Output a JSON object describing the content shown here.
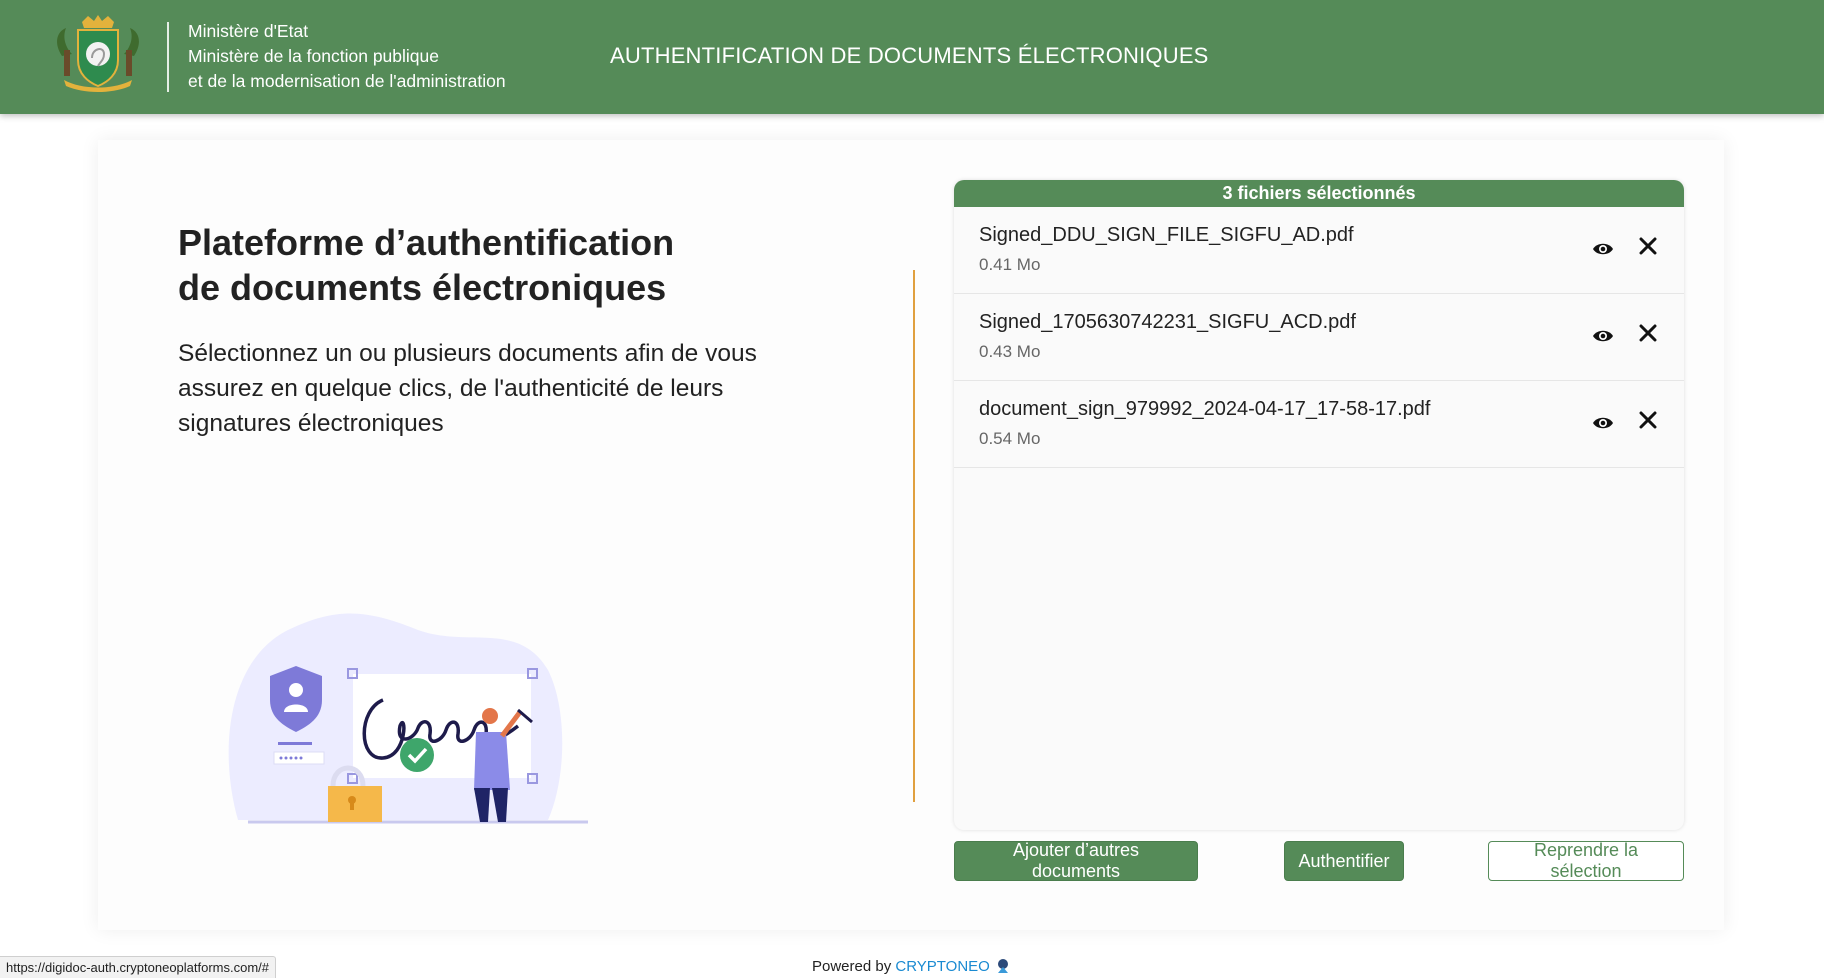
{
  "header": {
    "ministry_lines": [
      "Ministère d'Etat",
      "Ministère de la fonction publique",
      "et de la modernisation de l'administration"
    ],
    "title": "AUTHENTIFICATION DE DOCUMENTS ÉLECTRONIQUES",
    "emblem_icon": "coat-of-arms-icon"
  },
  "main": {
    "title_line1": "Plateforme d’authentification",
    "title_line2": "de documents électroniques",
    "description": "Sélectionnez un ou plusieurs documents afin de vous assurez en quelque clics, de l'authenticité de leurs signatures électroniques"
  },
  "files": {
    "header": "3 fichiers sélectionnés",
    "items": [
      {
        "name": "Signed_DDU_SIGN_FILE_SIGFU_AD.pdf",
        "size": "0.41 Mo"
      },
      {
        "name": "Signed_1705630742231_SIGFU_ACD.pdf",
        "size": "0.43 Mo"
      },
      {
        "name": "document_sign_979992_2024-04-17_17-58-17.pdf",
        "size": "0.54 Mo"
      }
    ]
  },
  "actions": {
    "add_label": "Ajouter d’autres documents",
    "authenticate_label": "Authentifier",
    "reset_label": "Reprendre la sélection"
  },
  "footer": {
    "powered_by": "Powered by",
    "brand": "CRYPTONEO"
  },
  "status_bar": {
    "url": "https://digidoc-auth.cryptoneoplatforms.com/#"
  },
  "colors": {
    "primary_green": "#558b58",
    "divider_orange": "#e0a040",
    "brand_blue": "#1a8ad1"
  }
}
